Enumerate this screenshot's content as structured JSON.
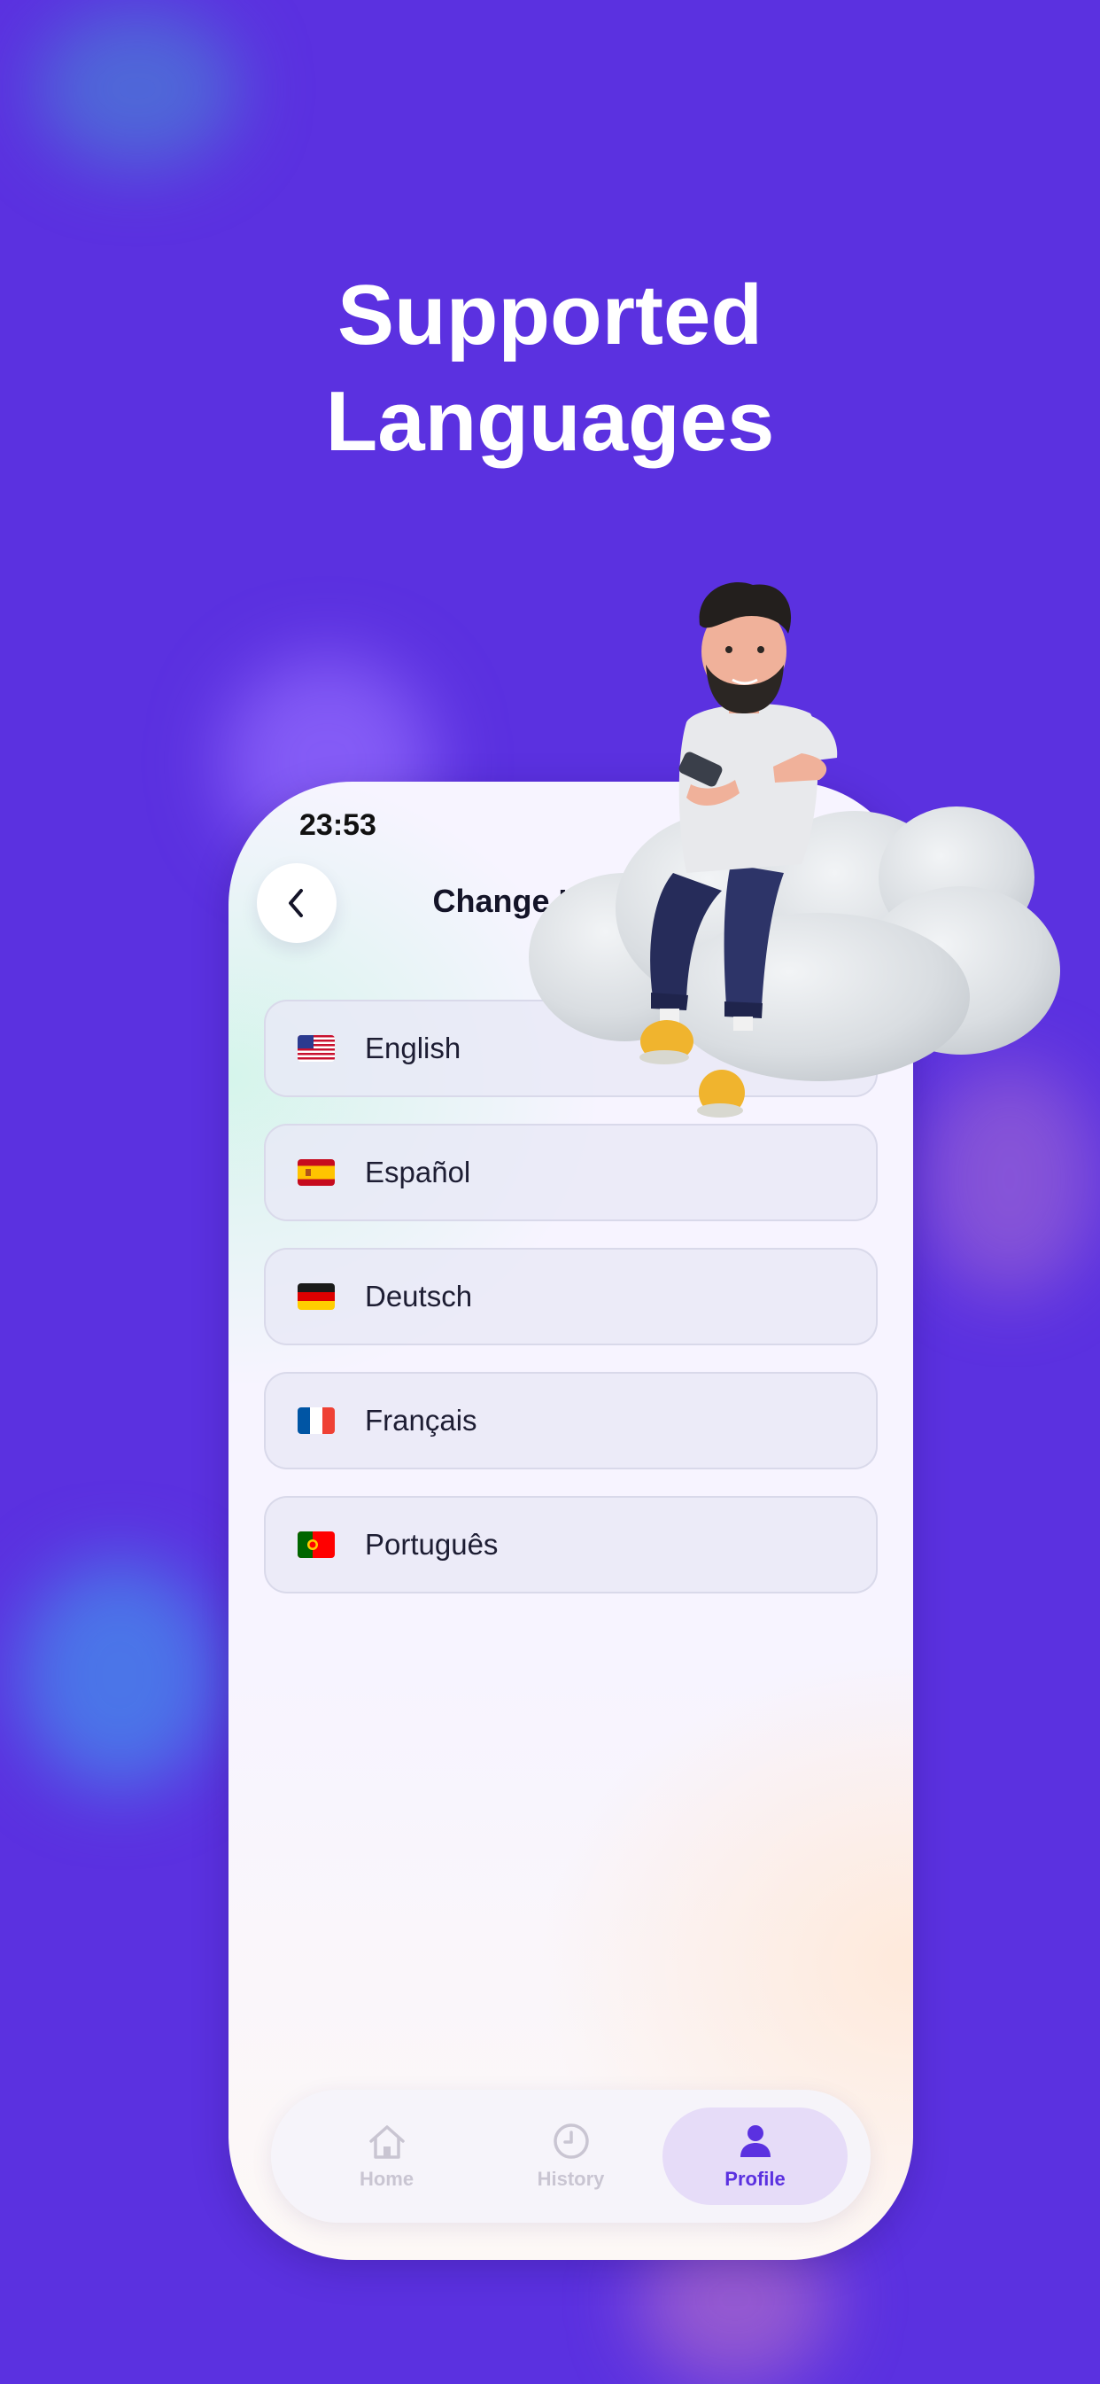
{
  "headline": {
    "line1": "Supported",
    "line2": "Languages"
  },
  "status_bar": {
    "time": "23:53"
  },
  "screen": {
    "title": "Change Language"
  },
  "languages": [
    {
      "label": "English",
      "flag": "us-flag-icon"
    },
    {
      "label": "Español",
      "flag": "spain-flag-icon"
    },
    {
      "label": "Deutsch",
      "flag": "germany-flag-icon"
    },
    {
      "label": "Français",
      "flag": "france-flag-icon"
    },
    {
      "label": "Português",
      "flag": "portugal-flag-icon"
    }
  ],
  "tabs": [
    {
      "label": "Home",
      "icon": "home-icon",
      "active": false
    },
    {
      "label": "History",
      "icon": "clock-icon",
      "active": false
    },
    {
      "label": "Profile",
      "icon": "person-icon",
      "active": true
    }
  ],
  "colors": {
    "background": "#5b31e0",
    "accent": "#5b31e0",
    "inactive_tab": "#c9c5d2"
  }
}
